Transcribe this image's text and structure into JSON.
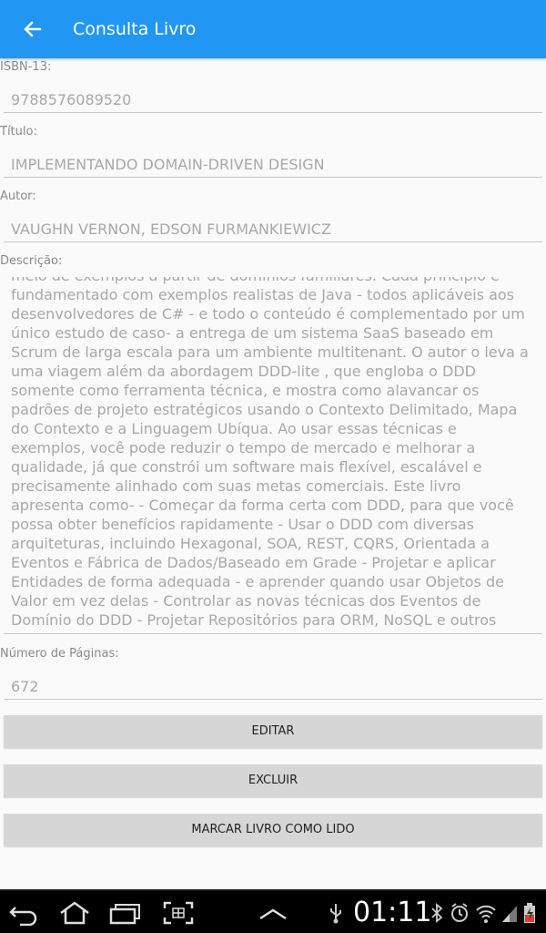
{
  "appbar": {
    "title": "Consulta Livro"
  },
  "fields": {
    "isbn": {
      "label": "ISBN-13:",
      "value": "9788576089520"
    },
    "titulo": {
      "label": "Título:",
      "value": "IMPLEMENTANDO DOMAIN-DRIVEN DESIGN"
    },
    "autor": {
      "label": "Autor:",
      "value": "VAUGHN VERNON, EDSON FURMANKIEWICZ"
    },
    "descricao": {
      "label": "Descrição:",
      "value": "meio de exemplos a partir de domínios familiares. Cada princípio é fundamentado com exemplos realistas de Java - todos aplicáveis aos desenvolvedores de C# - e todo o conteúdo é complementado por um único estudo de caso- a entrega de um sistema SaaS baseado em Scrum de larga escala para um ambiente multitenant. O autor o leva a uma viagem além da abordagem DDD-lite , que engloba o DDD somente como ferramenta técnica, e mostra como alavancar os padrões de projeto estratégicos usando o Contexto Delimitado, Mapa do Contexto e a Linguagem Ubíqua. Ao usar essas técnicas e exemplos, você pode reduzir o tempo de mercado e melhorar a qualidade, já que constrói um software mais flexível, escalável e precisamente alinhado com suas metas comerciais. Este livro apresenta como- - Começar da forma certa com DDD, para que você possa obter benefícios rapidamente - Usar o DDD com diversas arquiteturas, incluindo Hexagonal, SOA, REST, CQRS, Orientada a Eventos e Fábrica de Dados/Baseado em Grade - Projetar e aplicar Entidades de forma adequada - e aprender quando usar Objetos de Valor em vez delas - Controlar as novas técnicas dos Eventos de Domínio do DDD - Projetar Repositórios para ORM, NoSQL e outros bancos de dados"
    },
    "paginas": {
      "label": "Número de Páginas:",
      "value": "672"
    }
  },
  "buttons": {
    "editar": "EDITAR",
    "excluir": "EXCLUIR",
    "marcar": "MARCAR LIVRO COMO LIDO"
  },
  "statusbar": {
    "time": "01:11"
  },
  "icons": {
    "back": "arrow-back-icon",
    "nav_back": "nav-back-icon",
    "nav_home": "nav-home-icon",
    "nav_recent": "nav-recent-apps-icon",
    "nav_screenshot": "screenshot-icon",
    "nav_up": "chevron-up-icon",
    "usb": "usb-icon",
    "bluetooth": "bluetooth-icon",
    "alarm": "alarm-icon",
    "wifi": "wifi-icon",
    "signal": "signal-icon",
    "battery": "battery-icon"
  },
  "colors": {
    "primary": "#2196F3",
    "background": "#fafafa",
    "button": "#d6d6d6"
  }
}
